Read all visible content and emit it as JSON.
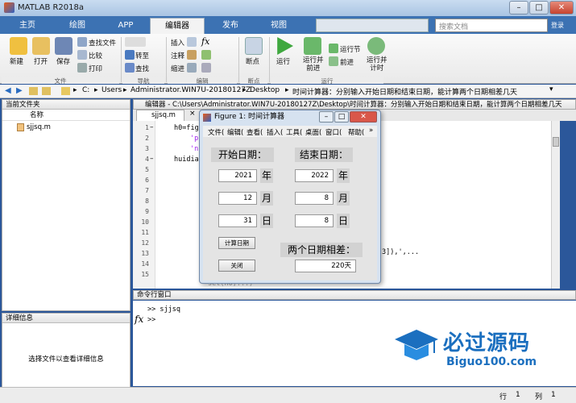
{
  "titlebar": {
    "title": "MATLAB R2018a"
  },
  "tabs": [
    "主页",
    "绘图",
    "APP",
    "编辑器",
    "发布",
    "视图"
  ],
  "search": {
    "placeholder": "搜索文档",
    "button": "登录"
  },
  "ribbon": {
    "new": "新建",
    "open": "打开",
    "save": "保存",
    "find_files": "查找文件",
    "compare": "比较",
    "print": "打印",
    "goto": "转至",
    "find": "查找",
    "insert": "插入",
    "comment": "注释",
    "indent": "缩进",
    "breakpoint": "断点",
    "run": "运行",
    "run_advance": "运行并\n前进",
    "run_section": "运行节",
    "advance": "前进",
    "run_time": "运行并\n计时",
    "groups": [
      "文件",
      "导航",
      "编辑",
      "断点",
      "运行"
    ]
  },
  "address": {
    "path": [
      "C:",
      "Users",
      "Administrator.WIN7U-20180127Z",
      "Desktop",
      "时间计算器：分别输入开始日期和结束日期，能计算两个日期相差几天"
    ]
  },
  "current_folder": {
    "title": "当前文件夹",
    "col": "名称",
    "files": [
      "sjjsq.m"
    ]
  },
  "details": {
    "title": "详细信息",
    "text": "选择文件以查看详细信息"
  },
  "editor": {
    "header": "编辑器 - C:\\Users\\Administrator.WIN7U-20180127Z\\Desktop\\时间计算器：分别输入开始日期和结束日期，能计算两个日期相差几天",
    "tab": "sjjsq.m",
    "lines": [
      "1",
      "2",
      "3",
      "4",
      "5",
      "6",
      "7",
      "8",
      "9",
      "10",
      "11",
      "12",
      "13",
      "14",
      "15"
    ],
    "code": [
      "h0=fig",
      "'p",
      "'n",
      "huidia",
      "",
      "",
      "",
      "",
      "",
      "",
      "",
      "3]),',...",
      "",
      "",
      "set(h0,...)"
    ]
  },
  "command": {
    "title": "命令行窗口",
    "lines": [
      ">> sjjsq",
      ">>"
    ]
  },
  "status": {
    "row_label": "行",
    "row": "1",
    "col_label": "列",
    "col": "1"
  },
  "figure": {
    "title": "Figure 1: 时间计算器",
    "menu": [
      "文件(",
      "编辑(",
      "查看(",
      "插入(",
      "工具(",
      "桌面(",
      "窗口(",
      "帮助("
    ],
    "start_label": "开始日期：",
    "end_label": "结束日期：",
    "start": {
      "year": "2021",
      "month": "12",
      "day": "31"
    },
    "end": {
      "year": "2022",
      "month": "8",
      "day": "8"
    },
    "year_unit": "年",
    "month_unit": "月",
    "day_unit": "日",
    "calc_button": "计算日期",
    "close_button": "关闭",
    "diff_label": "两个日期相差：",
    "diff_value": "220天"
  },
  "watermark": {
    "cn": "必过源码",
    "en": "Biguo100.com"
  }
}
